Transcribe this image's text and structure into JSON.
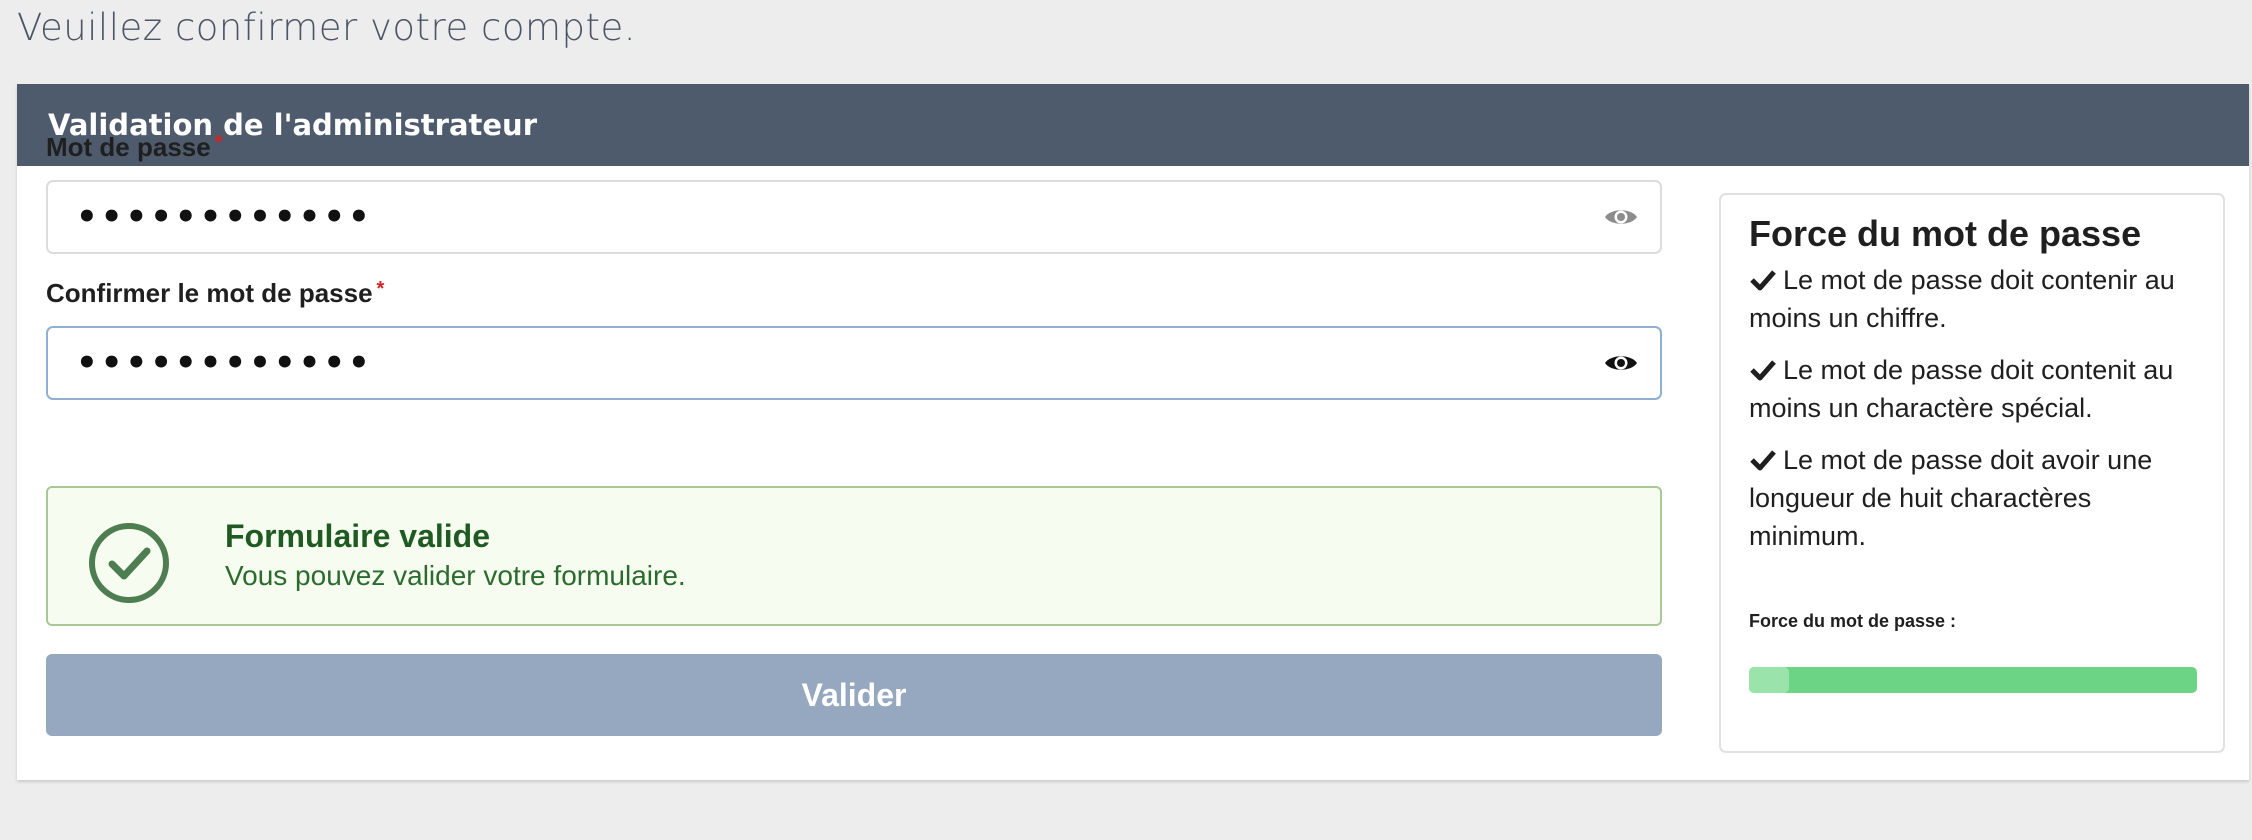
{
  "page": {
    "title": "Veuillez confirmer votre compte."
  },
  "card": {
    "header": "Validation de l'administrateur"
  },
  "form": {
    "password": {
      "label": "Mot de passe",
      "required_mark": "*",
      "masked_value": "••••••••••••"
    },
    "confirm": {
      "label": "Confirmer le mot de passe",
      "required_mark": "*",
      "masked_value": "••••••••••••"
    },
    "alert": {
      "title": "Formulaire valide",
      "text": "Vous pouvez valider votre formulaire.",
      "color": "#2b6b2e"
    },
    "submit_label": "Valider"
  },
  "strength": {
    "title": "Force du mot de passe",
    "rules": [
      {
        "text": "Le mot de passe doit contenir au moins un chiffre.",
        "met": true
      },
      {
        "text": "Le mot de passe doit contenit au moins un charactère spécial.",
        "met": true
      },
      {
        "text": "Le mot de passe doit avoir une longueur de huit charactères minimum.",
        "met": true
      }
    ],
    "meter_label": "Force du mot de passe :",
    "meter_level": 0.09,
    "meter_color": "#6bd585"
  },
  "icons": [
    "eye-icon",
    "check-circle-icon",
    "checkmark-icon"
  ]
}
